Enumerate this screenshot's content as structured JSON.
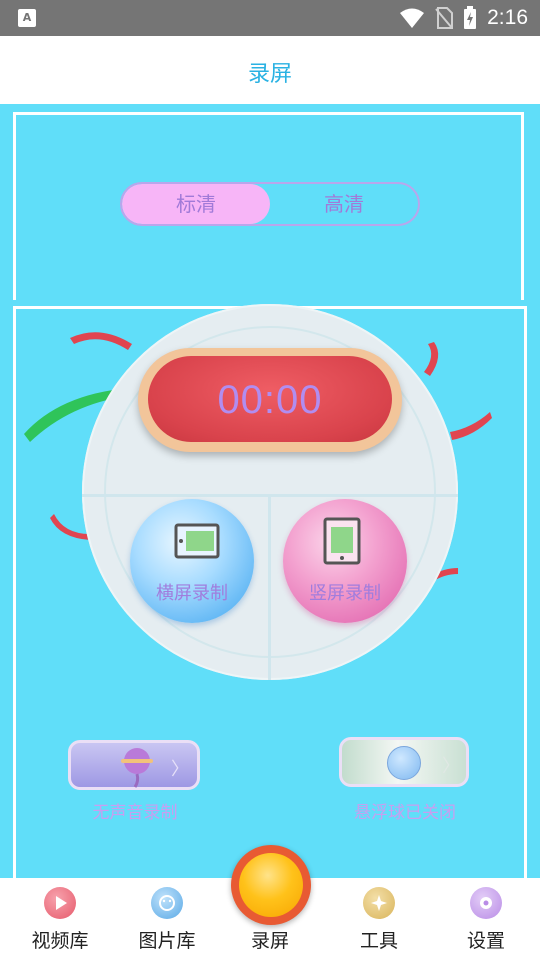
{
  "status_bar": {
    "time": "2:16",
    "notification_icon": "A"
  },
  "title": "录屏",
  "quality": {
    "options": [
      "标清",
      "高清"
    ],
    "selected": "标清"
  },
  "timer": "00:00",
  "record_modes": {
    "landscape": "横屏录制",
    "portrait": "竖屏录制"
  },
  "toggles": {
    "mute_label": "无声音录制",
    "float_label": "悬浮球已关闭"
  },
  "nav": [
    {
      "label": "视频库",
      "icon": "video-play-icon",
      "color": "#e65a6b"
    },
    {
      "label": "图片库",
      "icon": "image-icon",
      "color": "#5aa9e6"
    },
    {
      "label": "录屏",
      "icon": "record-icon",
      "color": "#ffc21a"
    },
    {
      "label": "工具",
      "icon": "tools-icon",
      "color": "#d9b45a"
    },
    {
      "label": "设置",
      "icon": "settings-icon",
      "color": "#b98ce6"
    }
  ],
  "colors": {
    "background": "#60def9",
    "accent": "#2ab2e3",
    "timer": "#d9434c",
    "record_button": "#ffc21a"
  }
}
